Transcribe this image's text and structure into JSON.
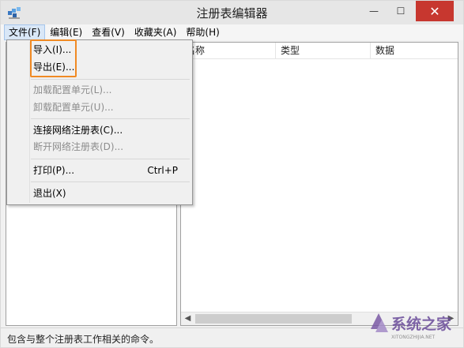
{
  "window": {
    "title": "注册表编辑器",
    "min_glyph": "—",
    "max_glyph": "☐",
    "close_glyph": "✕"
  },
  "menubar": {
    "items": [
      "文件(F)",
      "编辑(E)",
      "查看(V)",
      "收藏夹(A)",
      "帮助(H)"
    ]
  },
  "file_menu": {
    "import": "导入(I)...",
    "export": "导出(E)...",
    "load_hive": "加载配置单元(L)...",
    "unload_hive": "卸载配置单元(U)...",
    "connect_network": "连接网络注册表(C)...",
    "disconnect_network": "断开网络注册表(D)...",
    "print": "打印(P)...",
    "print_shortcut": "Ctrl+P",
    "exit": "退出(X)"
  },
  "list": {
    "columns": [
      "名称",
      "类型",
      "数据"
    ]
  },
  "statusbar": {
    "text": "包含与整个注册表工作相关的命令。"
  },
  "watermark": {
    "text": "系统之家",
    "subtext": "XITONGZHIJIA.NET"
  },
  "colors": {
    "highlight_border": "#f08a24",
    "close_button": "#c7372f",
    "menu_active_bg": "#d9e7f7"
  }
}
